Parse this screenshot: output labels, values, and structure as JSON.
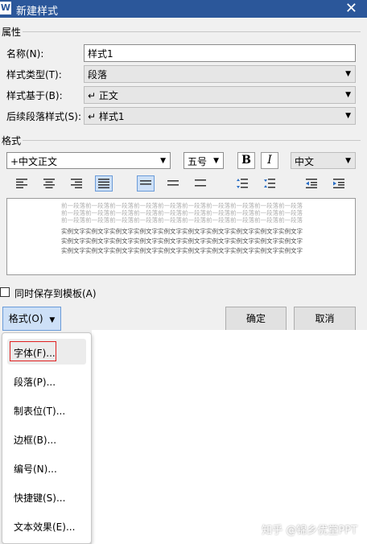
{
  "window": {
    "title": "新建样式",
    "app_icon": "W"
  },
  "properties": {
    "section_title": "属性",
    "name_label": "名称(N):",
    "name_value": "样式1",
    "type_label": "样式类型(T):",
    "type_value": "段落",
    "based_on_label": "样式基于(B):",
    "based_on_value": "↵ 正文",
    "next_label": "后续段落样式(S):",
    "next_value": "↵ 样式1"
  },
  "format": {
    "section_title": "格式",
    "font_value": "+中文正文",
    "size_value": "五号",
    "bold_label": "B",
    "italic_label": "I",
    "lang_value": "中文"
  },
  "preview": {
    "prev_text": "前一段落前一段落前一段落前一段落前一段落前一段落前一段落前一段落前一段落前一段落",
    "sample_text": "实例文字实例文字实例文字实例文字实例文字实例文字实例文字实例文字实例文字实例文字"
  },
  "save_to_template_label": "同时保存到模板(A)",
  "buttons": {
    "format": "格式(O)",
    "ok": "确定",
    "cancel": "取消"
  },
  "menu": {
    "items": [
      "字体(F)...",
      "段落(P)...",
      "制表位(T)...",
      "边框(B)...",
      "编号(N)...",
      "快捷键(S)...",
      "文本效果(E)..."
    ]
  },
  "watermark": "知乎 @锦乡优堂PPT",
  "colors": {
    "title_bar": "#2b579a",
    "highlight": "#cde0f7",
    "red_outline": "#e02020"
  }
}
